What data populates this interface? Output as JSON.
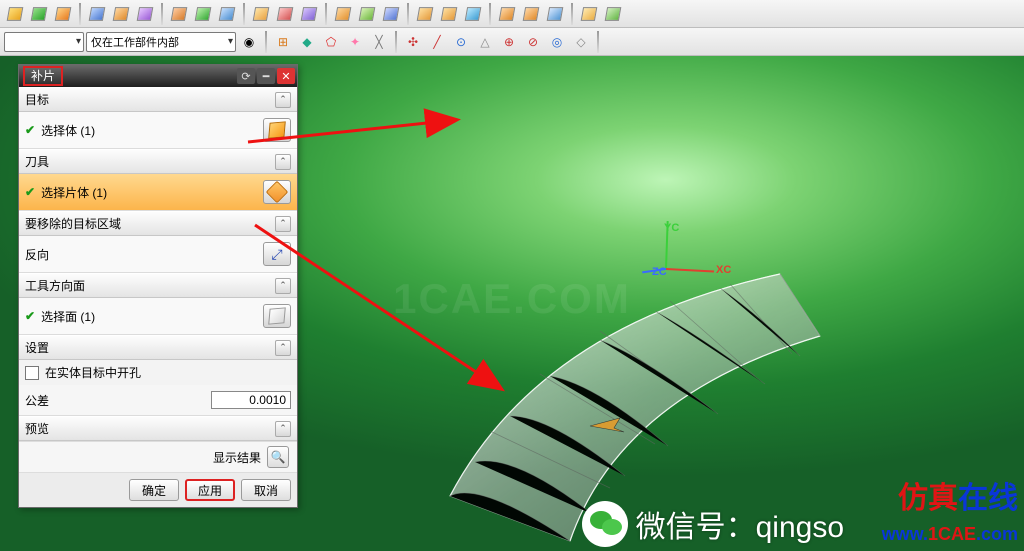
{
  "toolbar2": {
    "filter_scope": "仅在工作部件内部"
  },
  "dialog": {
    "title": "补片",
    "sections": {
      "target_header": "目标",
      "target_pick": "选择体 (1)",
      "tool_header": "刀具",
      "tool_pick": "选择片体 (1)",
      "remove_header": "要移除的目标区域",
      "reverse": "反向",
      "dir_header": "工具方向面",
      "dir_pick": "选择面 (1)",
      "settings_header": "设置",
      "checkbox_label": "在实体目标中开孔",
      "tolerance_label": "公差",
      "tolerance_value": "0.0010",
      "preview_header": "预览",
      "show_result": "显示结果"
    },
    "buttons": {
      "ok": "确定",
      "apply": "应用",
      "cancel": "取消"
    }
  },
  "viewport": {
    "axis_x": "XC",
    "axis_y": "YC",
    "axis_z": "ZC",
    "watermark": "1CAE.COM"
  },
  "overlays": {
    "wechat_prefix": "微信号：",
    "wechat_id": "qingso",
    "brand_zh_a": "仿真",
    "brand_zh_b": "在线",
    "brand_url_a": "www.",
    "brand_url_b": "1CAE",
    "brand_url_c": ".com"
  }
}
